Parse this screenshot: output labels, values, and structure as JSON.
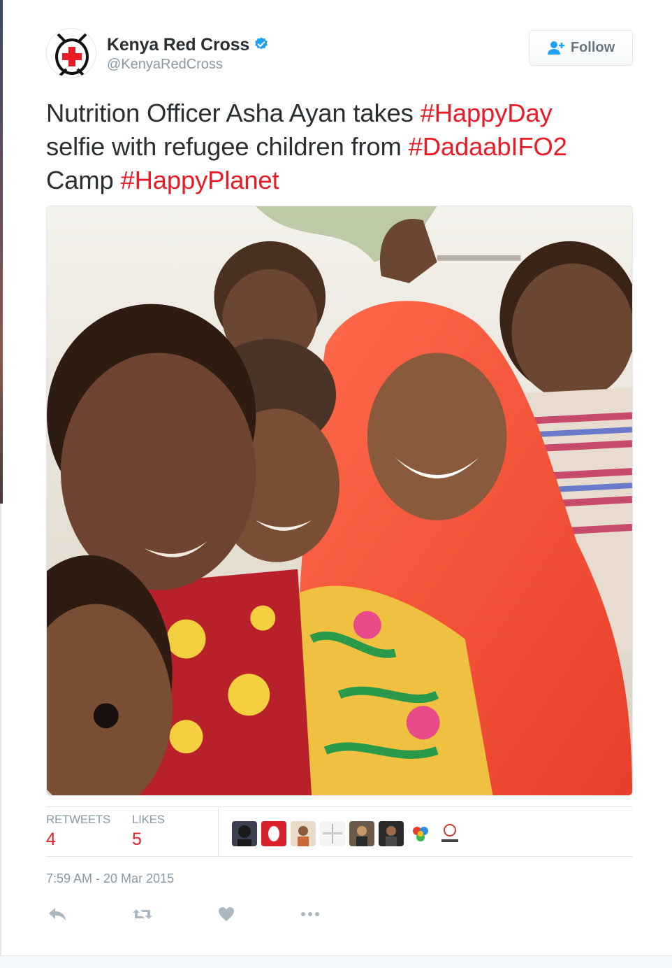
{
  "account": {
    "name": "Kenya Red Cross",
    "handle": "@KenyaRedCross",
    "verified": true,
    "avatar_icon": "red-cross-logo"
  },
  "follow_button": {
    "label": "Follow",
    "icon": "follow-person-plus-icon"
  },
  "tweet": {
    "segments": [
      {
        "text": "Nutrition Officer Asha Ayan takes ",
        "hashtag": false
      },
      {
        "text": "#HappyDay",
        "hashtag": true
      },
      {
        "text": " selfie with refugee children from ",
        "hashtag": false
      },
      {
        "text": "#DadaabIFO2",
        "hashtag": true
      },
      {
        "text": " Camp ",
        "hashtag": false
      },
      {
        "text": "#HappyPlanet",
        "hashtag": true
      }
    ]
  },
  "stats": {
    "retweets_label": "RETWEETS",
    "retweets_value": "4",
    "likes_label": "LIKES",
    "likes_value": "5"
  },
  "timestamp": "7:59 AM - 20 Mar 2015",
  "actions": [
    "reply-icon",
    "retweet-icon",
    "like-heart-icon",
    "more-icon"
  ],
  "colors": {
    "hashtag": "#e81c24",
    "muted": "#8899a6",
    "border": "#e1e8ed",
    "verified": "#1da1f2"
  }
}
